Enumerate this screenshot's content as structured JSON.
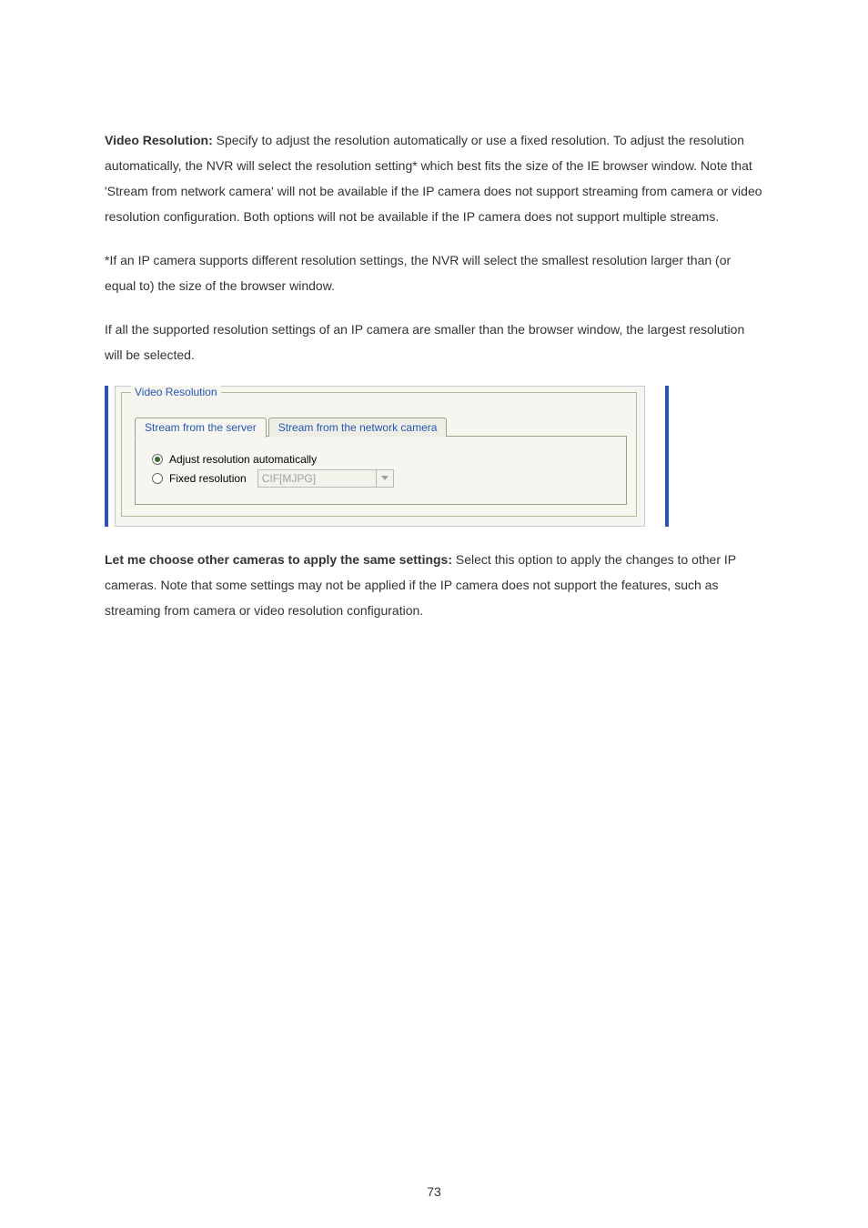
{
  "para1": {
    "lead_bold": "Video Resolution:",
    "rest": " Specify to adjust the resolution automatically or use a fixed resolution. To adjust the resolution automatically, the NVR will select the resolution setting* which best fits the size of the IE browser window.   Note that 'Stream from network camera' will not be available if the IP camera does not support streaming from camera or video resolution configuration.   Both options will not be available if the IP camera does not support multiple streams."
  },
  "para2": "*If an IP camera supports different resolution settings, the NVR will select the smallest resolution larger than (or equal to) the size of the browser window.",
  "para3": "If all the supported resolution settings of an IP camera are smaller than the browser window, the largest resolution will be selected.",
  "dialog": {
    "group_title": "Video Resolution",
    "tabs": {
      "active": "Stream from the server",
      "inactive": "Stream from the network camera"
    },
    "radio_auto": "Adjust resolution automatically",
    "radio_fixed": "Fixed resolution",
    "combo_value": "CIF[MJPG]"
  },
  "para4": {
    "lead_bold": "Let me choose other cameras to apply the same settings:",
    "rest": " Select this option to apply the changes to other IP cameras.   Note that some settings may not be applied if the IP camera does not support the features, such as streaming from camera or video resolution configuration."
  },
  "page_number": "73"
}
